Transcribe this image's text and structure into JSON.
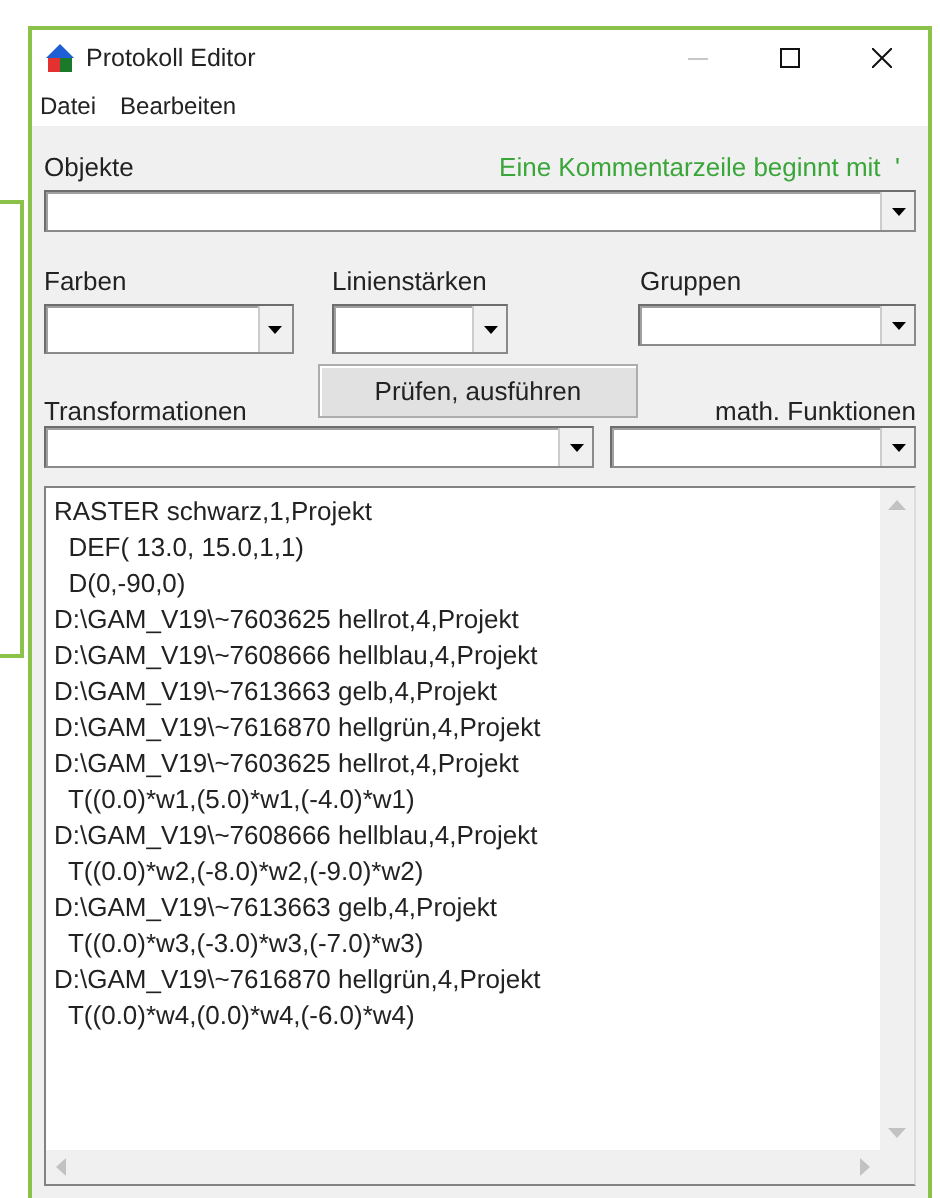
{
  "window": {
    "title": "Protokoll Editor"
  },
  "menu": [
    {
      "label": "Datei"
    },
    {
      "label": "Bearbeiten"
    }
  ],
  "objects": {
    "label": "Objekte"
  },
  "comment_hint": "Eine Kommentarzeile beginnt mit  '",
  "colors": {
    "label": "Farben"
  },
  "line_widths": {
    "label": "Linienstärken"
  },
  "groups": {
    "label": "Gruppen"
  },
  "check_button": "Prüfen, ausführen",
  "transformations": {
    "label": "Transformationen"
  },
  "math_functions": {
    "label": "math. Funktionen"
  },
  "editor": {
    "lines": [
      "RASTER schwarz,1,Projekt",
      "  DEF( 13.0, 15.0,1,1)",
      "  D(0,-90,0)",
      "D:\\GAM_V19\\~7603625 hellrot,4,Projekt",
      "D:\\GAM_V19\\~7608666 hellblau,4,Projekt",
      "D:\\GAM_V19\\~7613663 gelb,4,Projekt",
      "D:\\GAM_V19\\~7616870 hellgrün,4,Projekt",
      "D:\\GAM_V19\\~7603625 hellrot,4,Projekt",
      "  T((0.0)*w1,(5.0)*w1,(-4.0)*w1)",
      "D:\\GAM_V19\\~7608666 hellblau,4,Projekt",
      "  T((0.0)*w2,(-8.0)*w2,(-9.0)*w2)",
      "D:\\GAM_V19\\~7613663 gelb,4,Projekt",
      "  T((0.0)*w3,(-3.0)*w3,(-7.0)*w3)",
      "D:\\GAM_V19\\~7616870 hellgrün,4,Projekt",
      "  T((0.0)*w4,(0.0)*w4,(-6.0)*w4)"
    ]
  }
}
